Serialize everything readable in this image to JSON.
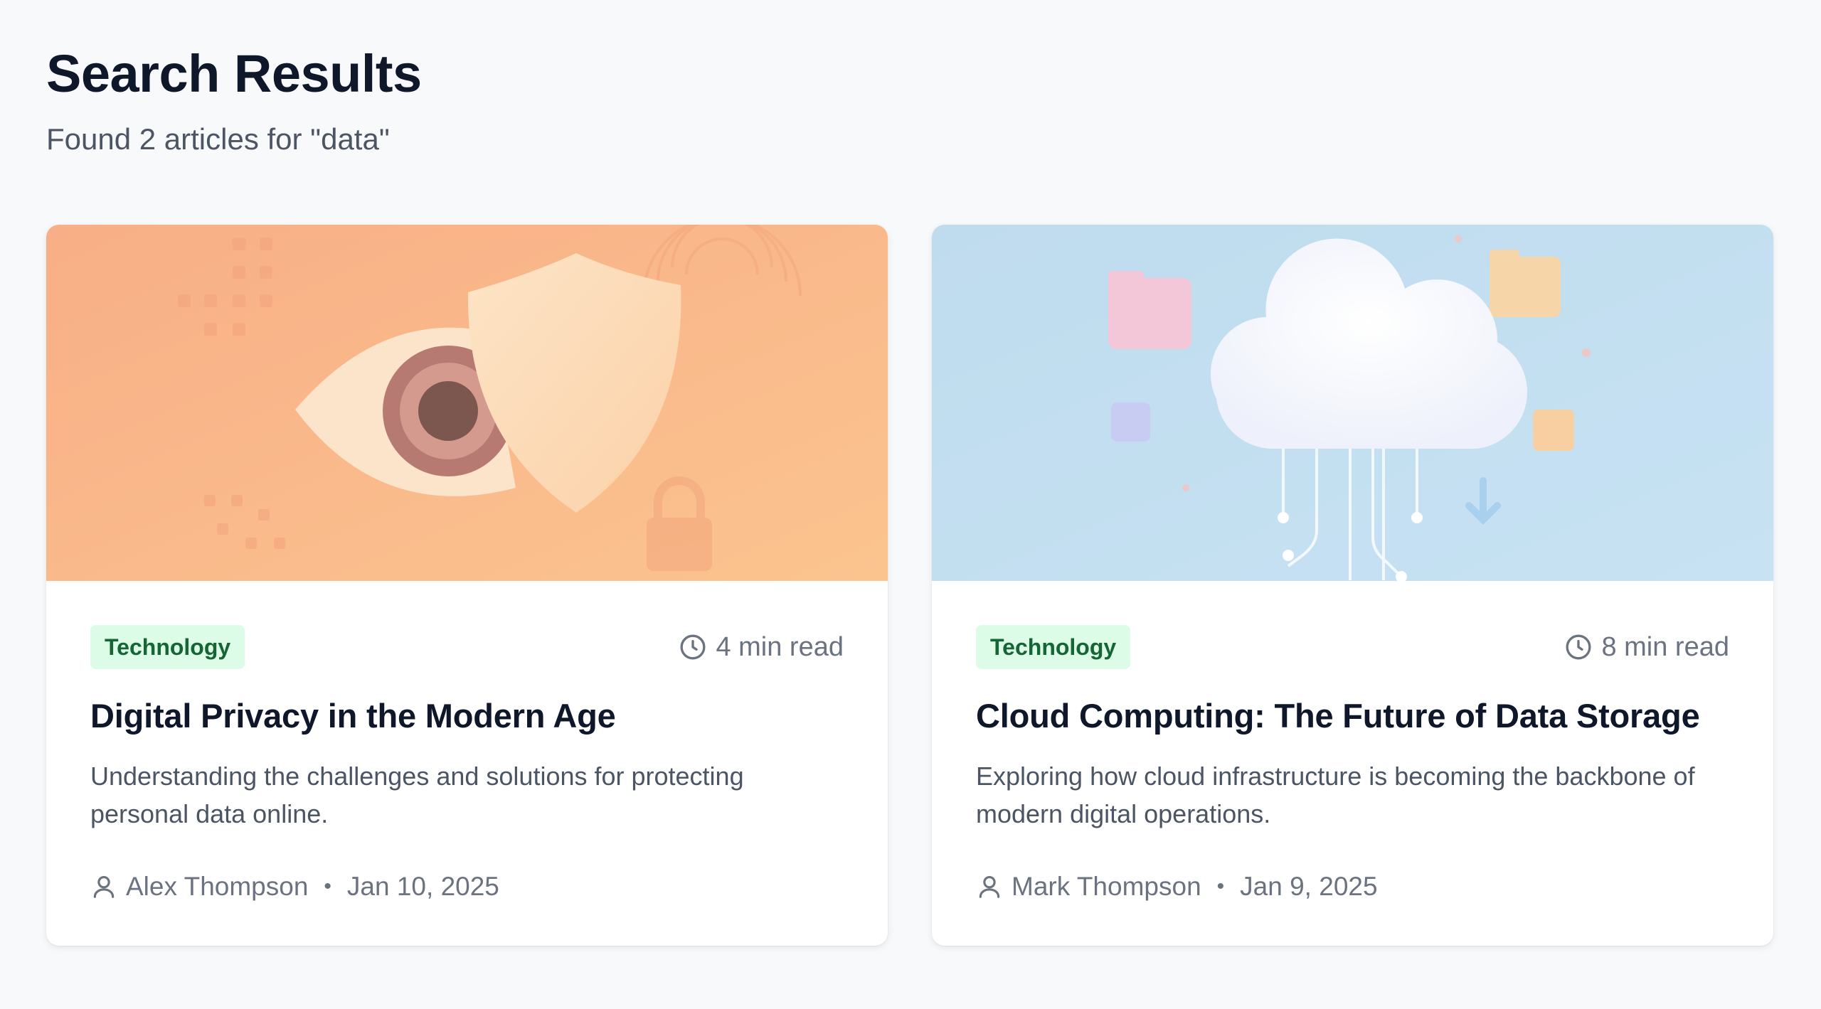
{
  "header": {
    "title": "Search Results",
    "subtitle": "Found 2 articles for \"data\""
  },
  "articles": [
    {
      "category": "Technology",
      "read_time": "4 min read",
      "title": "Digital Privacy in the Modern Age",
      "description": "Understanding the challenges and solutions for protecting personal data online.",
      "author": "Alex Thompson",
      "separator": "•",
      "date": "Jan 10, 2025",
      "image": "eye-and-shield-illustration"
    },
    {
      "category": "Technology",
      "read_time": "8 min read",
      "title": "Cloud Computing: The Future of Data Storage",
      "description": "Exploring how cloud infrastructure is becoming the backbone of modern digital operations.",
      "author": "Mark Thompson",
      "separator": "•",
      "date": "Jan 9, 2025",
      "image": "cloud-data-illustration"
    }
  ],
  "colors": {
    "background": "#f8f9fb",
    "badge_bg": "#dcfce7",
    "badge_text": "#166534",
    "title": "#0f172a",
    "muted": "#6b7280"
  },
  "icons": {
    "read_time": "clock-icon",
    "author": "user-icon"
  }
}
